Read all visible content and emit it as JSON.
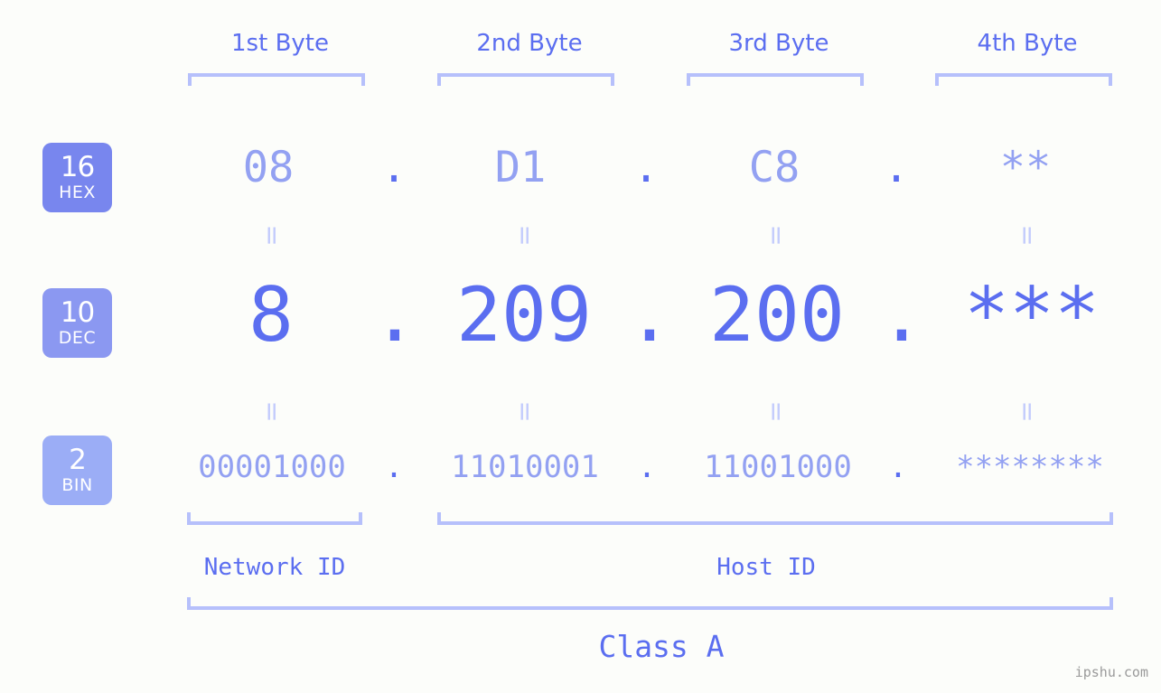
{
  "meta": {
    "watermark": "ipshu.com",
    "background_color": "#fcfdfa",
    "accent_strong": "#5b6ef0",
    "accent_light": "#93a1f2",
    "bracket_color": "#b6c0fb",
    "equals_color": "#c3ccfc"
  },
  "byte_headers": [
    {
      "label": "1st Byte"
    },
    {
      "label": "2nd Byte"
    },
    {
      "label": "3rd Byte"
    },
    {
      "label": "4th Byte"
    }
  ],
  "bases": [
    {
      "number": "16",
      "abbr": "HEX",
      "color": "#7886ee"
    },
    {
      "number": "10",
      "abbr": "DEC",
      "color": "#8b98f1"
    },
    {
      "number": "2",
      "abbr": "BIN",
      "color": "#9badf6"
    }
  ],
  "rows": {
    "hex": {
      "base_number": "16",
      "base_abbr": "HEX",
      "values": [
        "08",
        "D1",
        "C8",
        "**"
      ],
      "separator": "."
    },
    "dec": {
      "base_number": "10",
      "base_abbr": "DEC",
      "values": [
        "8",
        "209",
        "200",
        "***"
      ],
      "separator": "."
    },
    "bin": {
      "base_number": "2",
      "base_abbr": "BIN",
      "values": [
        "00001000",
        "11010001",
        "11001000",
        "********"
      ],
      "separator": "."
    }
  },
  "equals_marks": {
    "glyph": "=",
    "count_per_gap": 4
  },
  "segments": {
    "network_id": "Network ID",
    "host_id": "Host ID",
    "class": "Class A"
  }
}
